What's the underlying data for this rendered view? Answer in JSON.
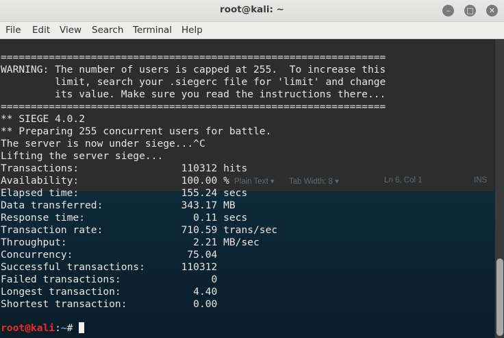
{
  "window": {
    "title": "root@kali: ~",
    "controls": {
      "minimize": "–",
      "maximize": "□",
      "close": "✕"
    }
  },
  "menu": [
    "File",
    "Edit",
    "View",
    "Search",
    "Terminal",
    "Help"
  ],
  "background_editor": {
    "plain_text": "Plain Text ▾",
    "tab_width": "Tab Width: 8 ▾",
    "position": "Ln 6, Col 1",
    "mode": "INS"
  },
  "terminal": {
    "lines": [
      "================================================================",
      "WARNING: The number of users is capped at 255.  To increase this",
      "         limit, search your .siegerc file for 'limit' and change",
      "         its value. Make sure you read the instructions there...",
      "================================================================",
      "** SIEGE 4.0.2",
      "** Preparing 255 concurrent users for battle.",
      "The server is now under siege...^C",
      "Lifting the server siege...",
      "Transactions:                 110312 hits",
      "Availability:                 100.00 %",
      "Elapsed time:                 155.24 secs",
      "Data transferred:             343.17 MB",
      "Response time:                  0.11 secs",
      "Transaction rate:             710.59 trans/sec",
      "Throughput:                     2.21 MB/sec",
      "Concurrency:                   75.04",
      "Successful transactions:      110312",
      "Failed transactions:               0",
      "Longest transaction:            4.40",
      "Shortest transaction:           0.00"
    ],
    "prompt": {
      "user_host": "root@kali",
      "separator": ":",
      "path": "~",
      "symbol": "# "
    }
  },
  "colors": {
    "prompt_user": "#ef2929",
    "prompt_path": "#729fcf",
    "terminal_bg": "#2d2d2d",
    "terminal_fg": "#e6e6e6"
  }
}
